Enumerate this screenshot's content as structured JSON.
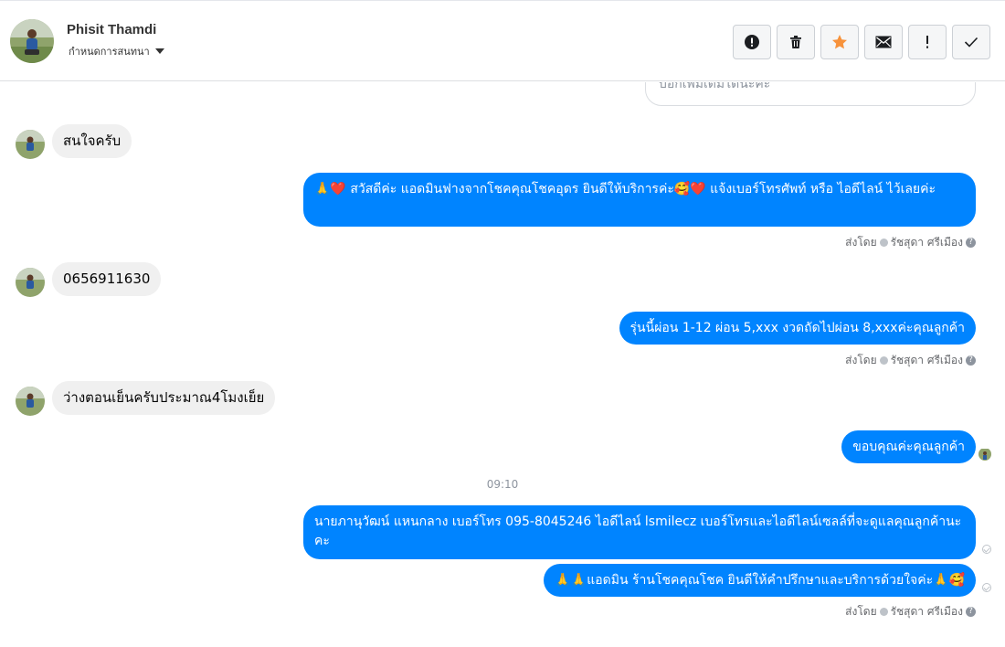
{
  "contact": {
    "name": "Phisit Thamdi",
    "assign_label": "กำหนดการสนทนา"
  },
  "toolbar": {
    "buttons": [
      "spam-report",
      "delete",
      "star",
      "mark-unread",
      "important",
      "done"
    ],
    "colors": {
      "star": "#f7923b",
      "icon": "#1c1e21"
    }
  },
  "thread": {
    "partial_text": "บอกเพิ่มเติมได้นะคะ",
    "messages": [
      {
        "side": "in",
        "text": "สนใจครับ"
      },
      {
        "side": "out",
        "text": "🙏❤️ สวัสดีค่ะ แอดมินฟางจากโชคคุณโชคอุดร ยินดีให้บริการค่ะ🥰❤️ แจ้งเบอร์โทรศัพท์ หรือ ไอดีไลน์  ไว้เลยค่ะ"
      },
      {
        "side": "in",
        "text": "0656911630"
      },
      {
        "side": "out",
        "text": "รุ่นนี้ผ่อน 1-12 ผ่อน 5,xxx งวดถัดไปผ่อน 8,xxxค่ะคุณลูกค้า"
      },
      {
        "side": "in",
        "text": "ว่างตอนเย็นครับประมาณ4โมงเย็ย"
      },
      {
        "side": "out",
        "text": "ขอบคุณค่ะคุณลูกค้า"
      },
      {
        "side": "out",
        "text": "นายภานุวัฒน์ แหนกลาง เบอร์โทร 095-8045246 ไอดีไลน์ lsmilecz  เบอร์โทรและไอดีไลน์เซลล์ที่จะดูแลคุณลูกค้านะคะ"
      },
      {
        "side": "out",
        "text": "🙏🙏แอดมิน ร้านโชคคุณโชค ยินดีให้คำปรึกษาและบริการด้วยใจค่ะ🙏🥰"
      }
    ],
    "sent_by_label": "ส่งโดย",
    "agent_name": "รัชสุดา ศรีเมือง",
    "time": "09:10"
  },
  "colors": {
    "outgoing": "#0084ff",
    "incoming": "#f0f0f0"
  }
}
